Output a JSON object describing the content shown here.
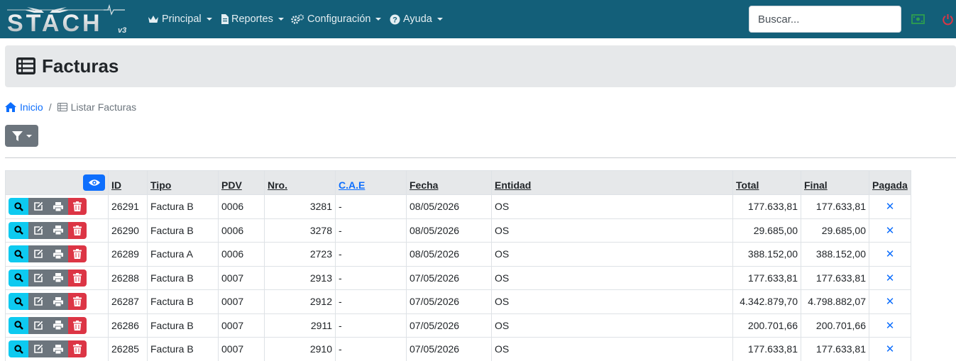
{
  "navbar": {
    "logo_text": "STACH",
    "logo_version": "v3",
    "menu": [
      {
        "label": "Principal",
        "icon": "crown-icon"
      },
      {
        "label": "Reportes",
        "icon": "file-icon"
      },
      {
        "label": "Configuración",
        "icon": "gears-icon"
      },
      {
        "label": "Ayuda",
        "icon": "question-circle-icon"
      }
    ],
    "search_placeholder": "Buscar...",
    "right_icons": [
      "money-bill-icon",
      "power-off-icon"
    ],
    "colors": {
      "bar": "#135f79",
      "money_icon": "#2e9e4f",
      "power_icon": "#dc3545"
    }
  },
  "page": {
    "title": "Facturas",
    "title_icon": "list-table-icon"
  },
  "breadcrumb": {
    "home": "Inicio",
    "separator": "/",
    "current": "Listar Facturas"
  },
  "filter_button": {
    "icon": "filter-icon"
  },
  "table": {
    "columns": [
      "ID",
      "Tipo",
      "PDV",
      "Nro.",
      "C.A.E",
      "Fecha",
      "Entidad",
      "Total",
      "Final",
      "Pagada"
    ],
    "row_actions": [
      "search-icon",
      "edit-icon",
      "print-icon",
      "trash-icon"
    ],
    "rows": [
      {
        "id": "26291",
        "tipo": "Factura B",
        "pdv": "0006",
        "nro": "3281",
        "cae": "-",
        "fecha": "08/05/2026",
        "entidad": "OS",
        "total": "177.633,81",
        "final": "177.633,81",
        "pagada": "✕"
      },
      {
        "id": "26290",
        "tipo": "Factura B",
        "pdv": "0006",
        "nro": "3278",
        "cae": "-",
        "fecha": "08/05/2026",
        "entidad": "OS",
        "total": "29.685,00",
        "final": "29.685,00",
        "pagada": "✕"
      },
      {
        "id": "26289",
        "tipo": "Factura A",
        "pdv": "0006",
        "nro": "2723",
        "cae": "-",
        "fecha": "08/05/2026",
        "entidad": "OS",
        "total": "388.152,00",
        "final": "388.152,00",
        "pagada": "✕"
      },
      {
        "id": "26288",
        "tipo": "Factura B",
        "pdv": "0007",
        "nro": "2913",
        "cae": "-",
        "fecha": "07/05/2026",
        "entidad": "OS",
        "total": "177.633,81",
        "final": "177.633,81",
        "pagada": "✕"
      },
      {
        "id": "26287",
        "tipo": "Factura B",
        "pdv": "0007",
        "nro": "2912",
        "cae": "-",
        "fecha": "07/05/2026",
        "entidad": "OS",
        "total": "4.342.879,70",
        "final": "4.798.882,07",
        "pagada": "✕"
      },
      {
        "id": "26286",
        "tipo": "Factura B",
        "pdv": "0007",
        "nro": "2911",
        "cae": "-",
        "fecha": "07/05/2026",
        "entidad": "OS",
        "total": "200.701,66",
        "final": "200.701,66",
        "pagada": "✕"
      },
      {
        "id": "26285",
        "tipo": "Factura B",
        "pdv": "0007",
        "nro": "2910",
        "cae": "-",
        "fecha": "07/05/2026",
        "entidad": "OS",
        "total": "177.633,81",
        "final": "177.633,81",
        "pagada": "✕"
      }
    ]
  }
}
